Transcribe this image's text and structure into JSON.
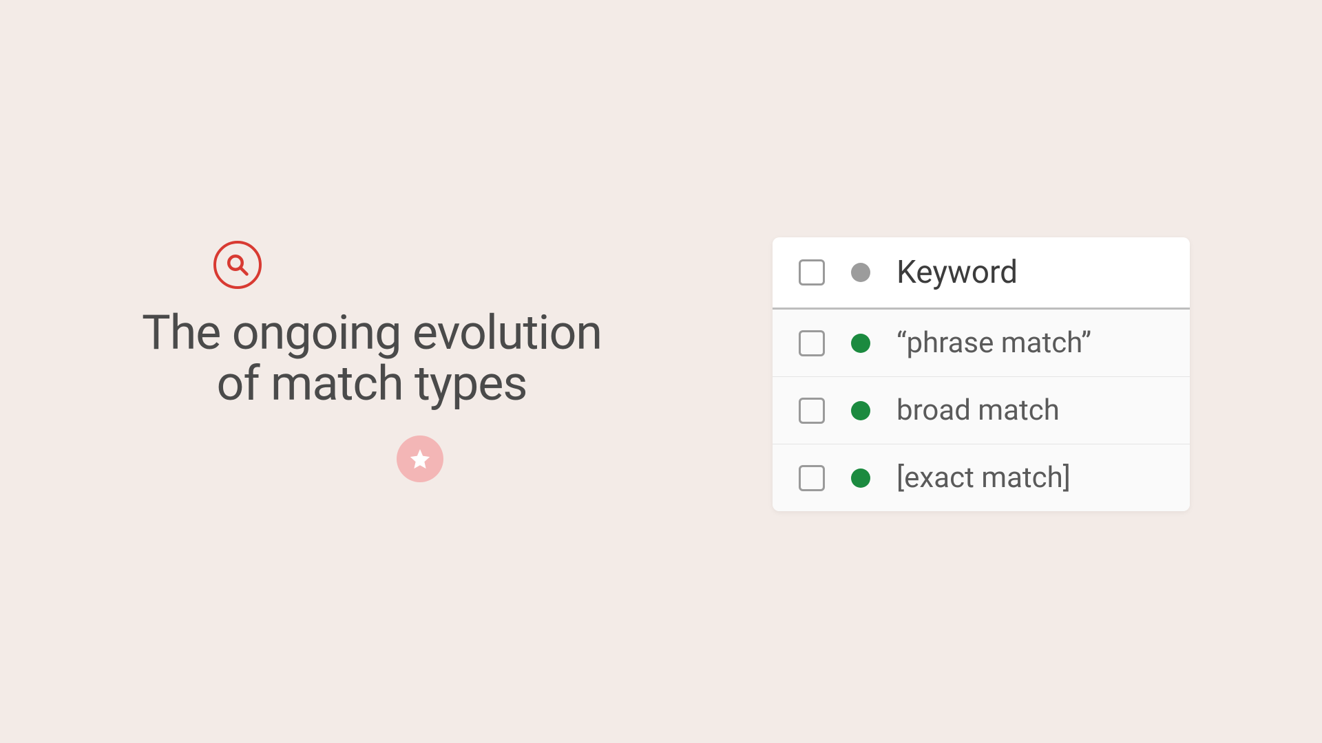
{
  "title_line1": "The ongoing evolution",
  "title_line2": "of match types",
  "table": {
    "header": "Keyword",
    "rows": [
      {
        "label": "“phrase match”"
      },
      {
        "label": "broad match"
      },
      {
        "label": "[exact match]"
      }
    ]
  }
}
